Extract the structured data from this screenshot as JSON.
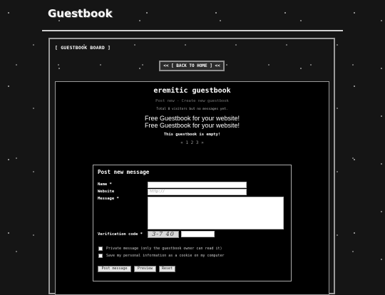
{
  "site": {
    "title": "Guestbook"
  },
  "board": {
    "label": "[ GUESTBOOK BOARD ]",
    "back_label": "<< [ BACK TO HOME ] <<"
  },
  "guestbook": {
    "title": "eremitic guestbook",
    "link_post_new": "Post new",
    "link_separator": " - ",
    "link_create": "Create new guestbook",
    "stats": "Total 0 visitors but no messages yet.",
    "promo_line1": "Free Guestbook for your website!",
    "promo_line2": "Free Guestbook for your website!",
    "empty_text": "This guestbook is empty!",
    "pager": "« 1 2 3 »"
  },
  "form": {
    "title": "Post new message",
    "name_label": "Name *",
    "website_label": "Website",
    "message_label": "Message *",
    "verification_label": "Verification code *",
    "name_value": "",
    "website_placeholder": "http://",
    "message_value": "",
    "captcha_text": "3-7 40",
    "private_label": "Private message (only the guestbook owner can read it)",
    "save_label": "Save my personal information as a cookie on my computer",
    "post_button": "Post message",
    "preview_button": "Preview",
    "reset_button": "Reset"
  }
}
